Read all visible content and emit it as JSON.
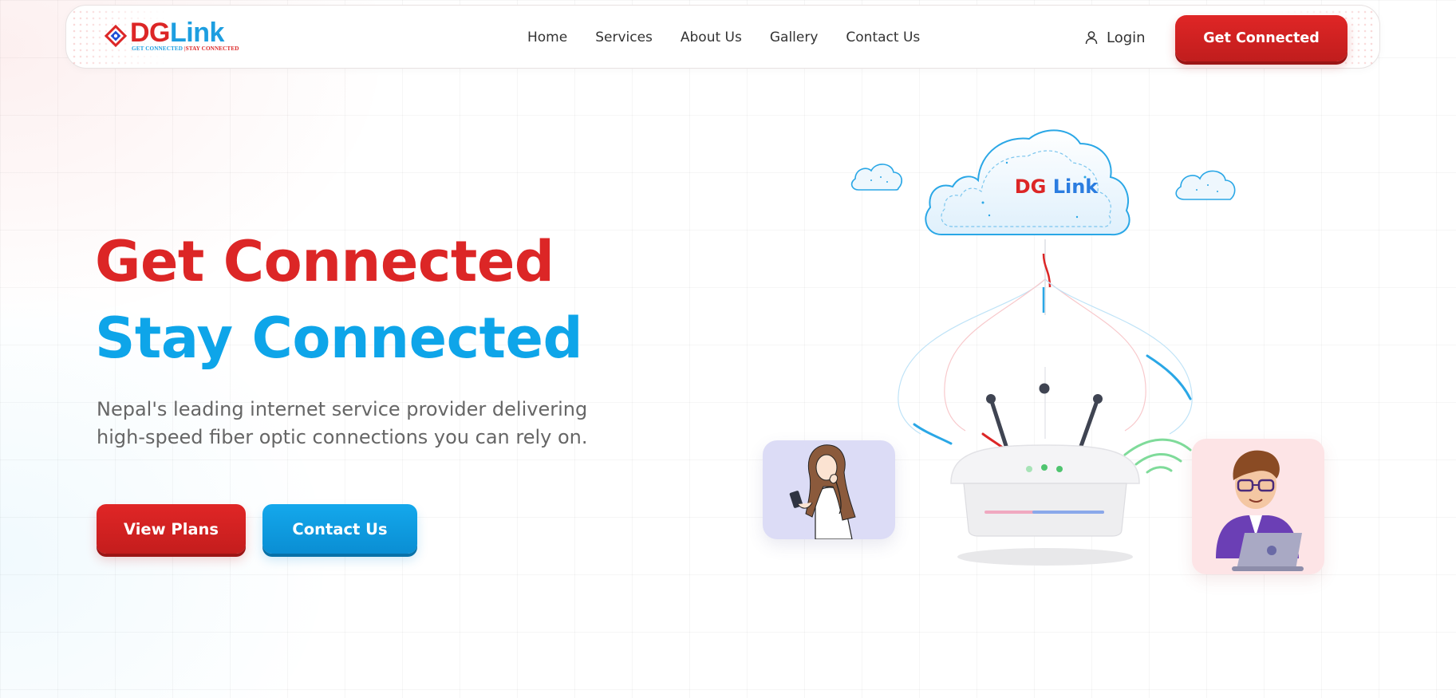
{
  "brand": {
    "name_part1": "DG",
    "name_part2": "Link",
    "tagline_part1": "GET CONNECTED",
    "tagline_part2": "|STAY CONNECTED"
  },
  "nav": {
    "items": [
      {
        "label": "Home"
      },
      {
        "label": "Services"
      },
      {
        "label": "About Us"
      },
      {
        "label": "Gallery"
      },
      {
        "label": "Contact Us"
      }
    ],
    "login_label": "Login",
    "cta_label": "Get Connected"
  },
  "hero": {
    "title_line1": "Get Connected",
    "title_line2": "Stay Connected",
    "description": "Nepal's leading internet service provider delivering high-speed fiber optic connections you can rely on.",
    "primary_button": "View Plans",
    "secondary_button": "Contact Us"
  },
  "illustration": {
    "cloud_label_part1": "DG",
    "cloud_label_part2": "Link",
    "icons": [
      "cloud-icon",
      "router-icon",
      "wifi-signal-icon",
      "woman-with-phone-illustration",
      "man-with-laptop-illustration"
    ]
  },
  "colors": {
    "brand_red": "#dc2626",
    "brand_blue": "#0ea5e9",
    "text_gray": "#666666"
  }
}
